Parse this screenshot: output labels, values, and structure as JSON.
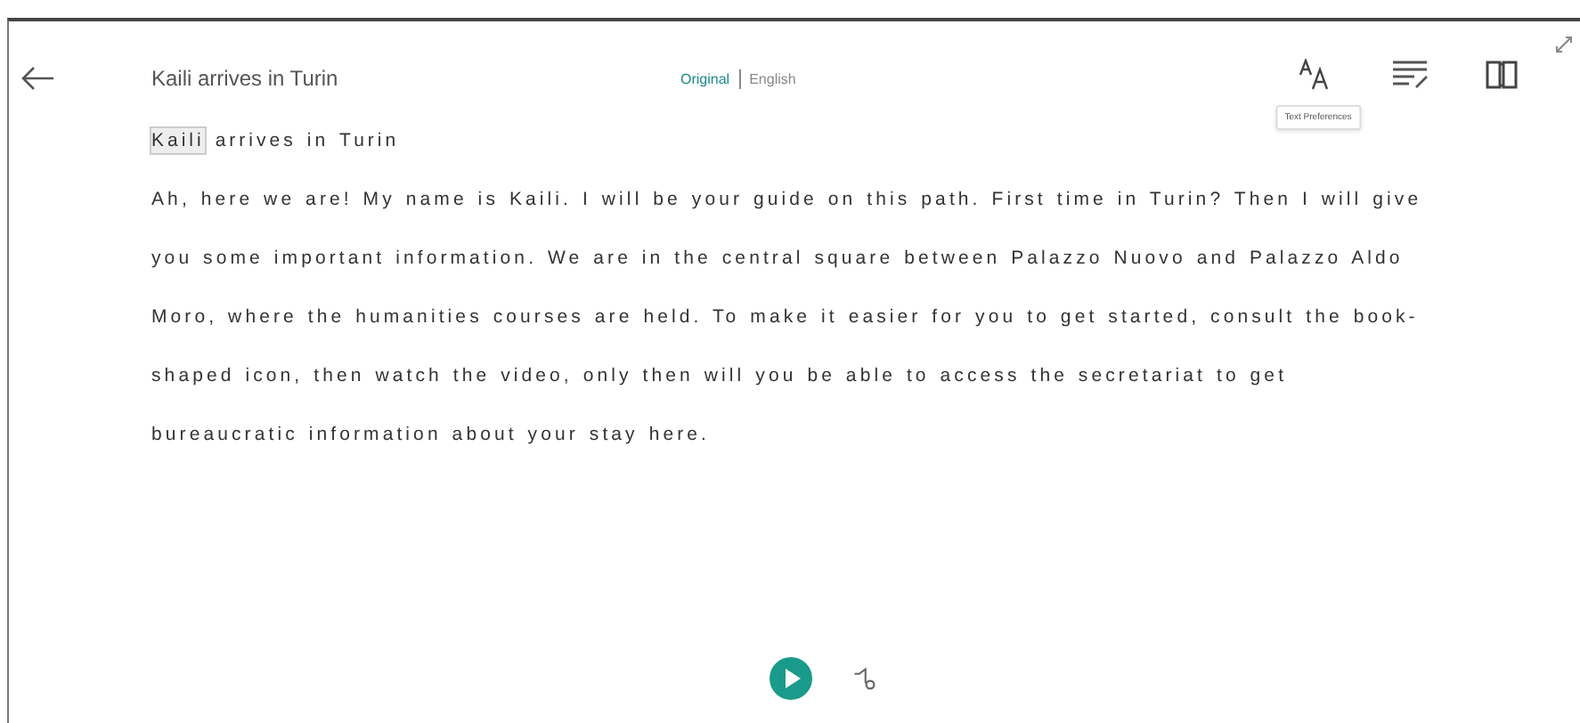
{
  "header": {
    "title": "Kaili arrives in Turin",
    "languages": [
      {
        "label": "Original",
        "selected": true
      },
      {
        "label": "English",
        "selected": false
      }
    ],
    "tooltip": "Text Preferences"
  },
  "heading": {
    "words": [
      {
        "text": "Kaili",
        "highlighted": true
      },
      {
        "text": "arrives",
        "highlighted": false
      },
      {
        "text": "in",
        "highlighted": false
      },
      {
        "text": "Turin",
        "highlighted": false
      }
    ]
  },
  "paragraph": "Ah, here we are! My name is Kaili. I will be your guide on this path. First time in Turin? Then I will give you some important information. We are in the central square between Palazzo Nuovo and Palazzo Aldo Moro, where the humanities courses are held. To make it easier for you to get started, consult the book-shaped icon, then watch the video, only then will you be able to access the secretariat to get bureaucratic information about your stay here."
}
